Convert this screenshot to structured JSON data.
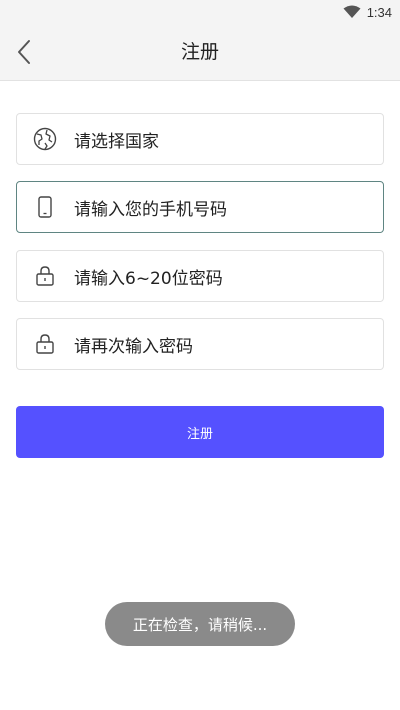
{
  "status_bar": {
    "time": "1:34",
    "icons": [
      "wifi-icon"
    ]
  },
  "header": {
    "title": "注册",
    "back_icon": "chevron-left-icon"
  },
  "form": {
    "fields": [
      {
        "icon": "globe-icon",
        "placeholder": "请选择国家"
      },
      {
        "icon": "phone-icon",
        "placeholder": "请输入您的手机号码",
        "focused": true
      },
      {
        "icon": "lock-icon",
        "placeholder": "请输入6~20位密码"
      },
      {
        "icon": "lock-icon",
        "placeholder": "请再次输入密码"
      }
    ],
    "submit_label": "注册"
  },
  "toast": {
    "text": "正在检查，请稍候..."
  },
  "colors": {
    "accent": "#5551ff",
    "focus_border": "#5f8582",
    "toast_bg": "#8a8a8a"
  }
}
